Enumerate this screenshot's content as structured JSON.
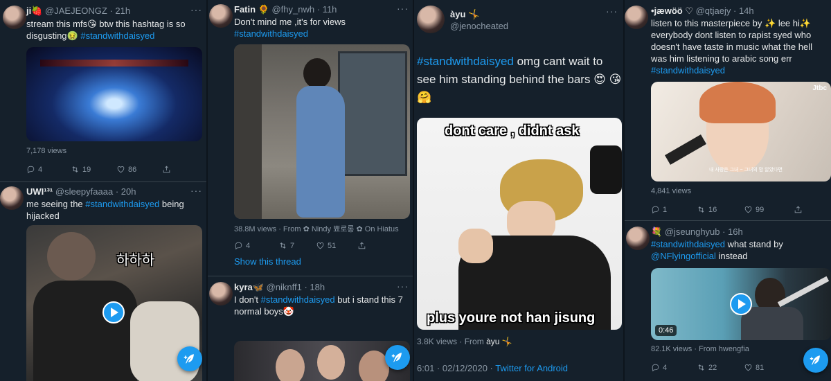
{
  "icons": {
    "reply": "reply-icon",
    "retweet": "retweet-icon",
    "like": "heart-icon",
    "share": "share-icon",
    "compose": "compose-tweet-icon",
    "play": "play-icon",
    "more": "more-icon"
  },
  "colors": {
    "background": "#15202b",
    "accent": "#1d9bf0",
    "muted": "#8b98a5",
    "text": "#e7e9ea"
  },
  "col1": {
    "t1": {
      "name": "ji🍓",
      "handle": "@JAEJEONGZ",
      "time": "· 21h",
      "text": "stream this mfs😘 btw this hashtag is so disgusting🤢 ",
      "hashtag": "#standwithdaisyed",
      "views": "7,178 views",
      "replies": "4",
      "retweets": "19",
      "likes": "86"
    },
    "t2": {
      "name": "UWI¹³¹",
      "handle": "@sleepyfaaaa",
      "time": "· 20h",
      "text_pre": "me seeing the ",
      "hashtag": "#standwithdaisyed",
      "text_post": " being hijacked",
      "overlay": "하하하"
    }
  },
  "col2": {
    "t1": {
      "name": "Fatin 🌻",
      "handle": "@fhy_nwh",
      "time": "· 11h",
      "text": "Don't mind me ,it's for views ",
      "hashtag": "#standwithdaisyed",
      "views": "38.8M views · From ✿ Nindy 뾰로롱 ✿ On Hiatus",
      "replies": "4",
      "retweets": "7",
      "likes": "51",
      "thread": "Show this thread"
    },
    "t2": {
      "name": "kyra🦋",
      "handle": "@niknff1",
      "time": "· 18h",
      "text_pre": "I don't ",
      "hashtag": "#standwithdaisyed",
      "text_post": " but i stand this 7 normal boys🤡"
    }
  },
  "col3": {
    "name": "àyu 🤸",
    "handle": "@jenocheated",
    "hashtag": "#standwithdaisyed",
    "text": " omg cant wait to see him standing behind the bars 😍 😘 🤗",
    "caption_top": "dont care , didnt ask",
    "caption_bottom": "plus youre not han jisung",
    "views": "3.8K views",
    "from_label": "From",
    "from_name": "àyu 🤸",
    "timestamp": "6:01 · 02/12/2020 · ",
    "client": "Twitter for Android"
  },
  "col4": {
    "t1": {
      "name": "•jæwöö ♡",
      "handle": "@qtjaejy",
      "time": "· 14h",
      "text": "listen to this masterpiece by ✨ lee hi✨ everybody dont listen to rapist syed who doesn't have taste in music what the hell was him listening to arabic song err ",
      "hashtag": "#standwithdaisyed",
      "views": "4,841 views",
      "replies": "1",
      "retweets": "16",
      "likes": "99",
      "logo": "Jtbc",
      "subtitle": "내 사랑은 그녀 ~ 그녀의 맘 알았다면"
    },
    "t2": {
      "name": "💐",
      "handle": "@jseunghyub",
      "time": "· 16h",
      "hashtag": "#standwithdaisyed",
      "text_mid": " what stand by ",
      "mention": "@NFlyingofficial",
      "text_post": " instead",
      "duration": "0:46",
      "views": "82.1K views · From hwengfia",
      "replies": "4",
      "retweets": "22",
      "likes": "81"
    }
  }
}
